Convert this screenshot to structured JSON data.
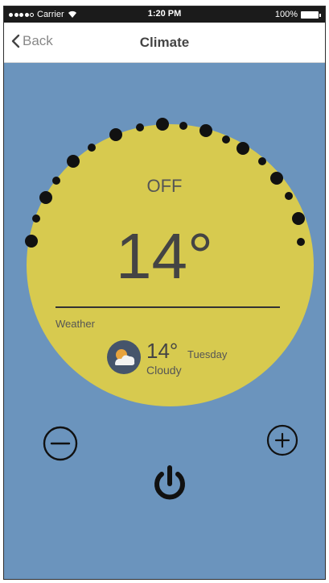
{
  "status_bar": {
    "carrier": "Carrier",
    "time": "1:20 PM",
    "battery": "100%"
  },
  "nav": {
    "back_label": "Back",
    "title": "Climate"
  },
  "thermostat": {
    "mode": "OFF",
    "temperature": "14°",
    "dial_color": "#d7ca4f",
    "background_color": "#6b94bd"
  },
  "weather": {
    "label": "Weather",
    "temperature": "14°",
    "day": "Tuesday",
    "condition": "Cloudy",
    "icon": "partly-cloudy-icon"
  },
  "controls": {
    "decrease_icon": "minus-circle-icon",
    "increase_icon": "plus-circle-icon",
    "power_icon": "power-icon"
  }
}
